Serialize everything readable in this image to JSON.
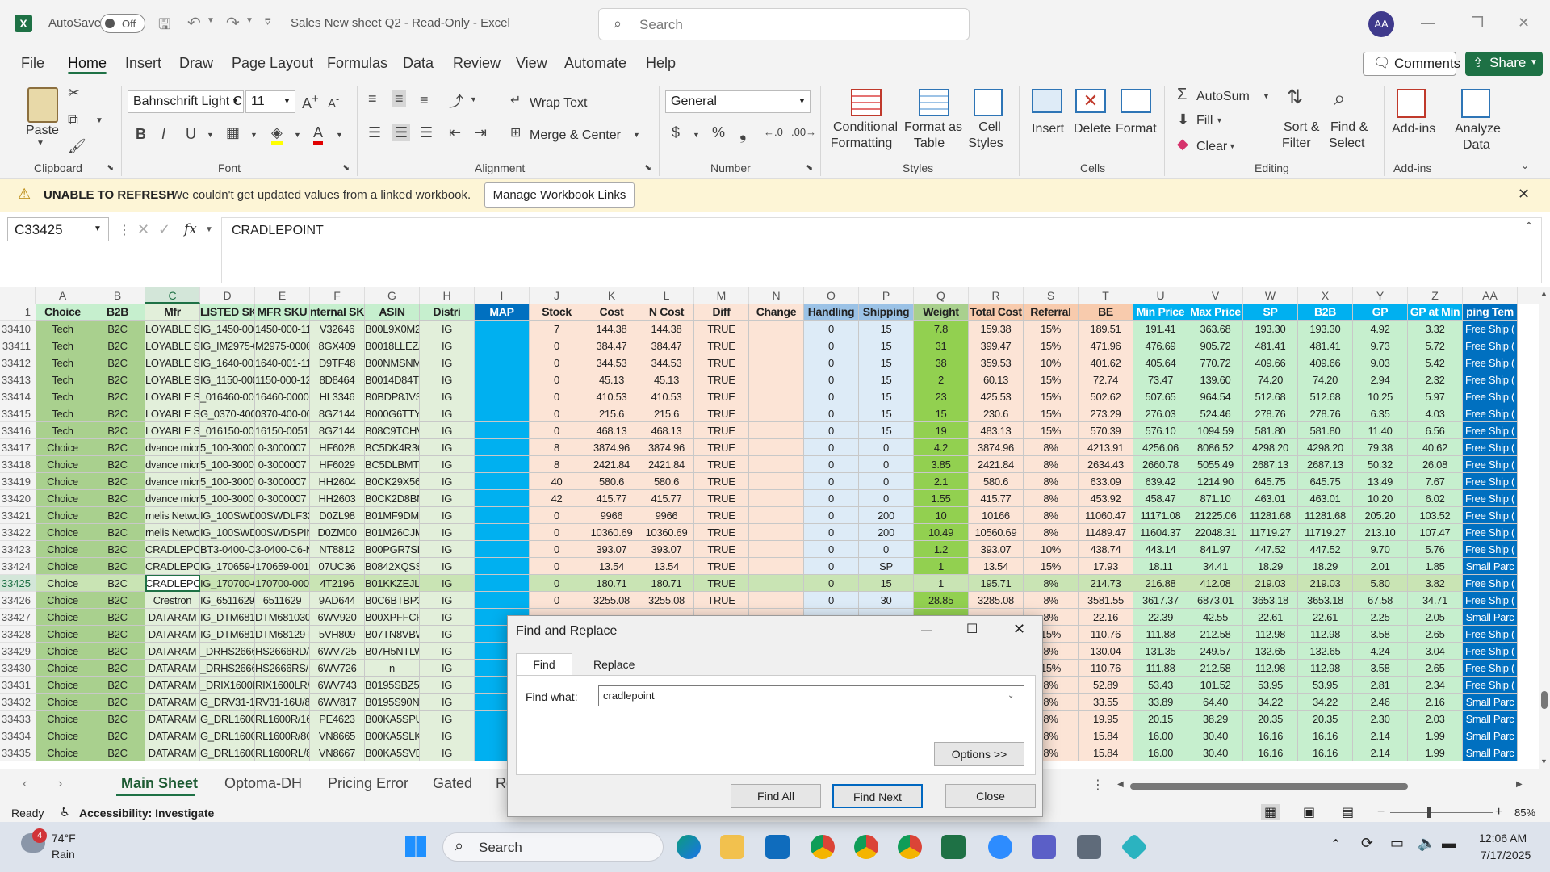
{
  "window": {
    "autosave_label": "AutoSave",
    "autosave_state": "Off",
    "title": "Sales New sheet Q2  -  Read-Only  -  Excel",
    "search_placeholder": "Search",
    "user_initials": "AA"
  },
  "menu": {
    "items": [
      "File",
      "Home",
      "Insert",
      "Draw",
      "Page Layout",
      "Formulas",
      "Data",
      "Review",
      "View",
      "Automate",
      "Help"
    ],
    "comments": "Comments",
    "share": "Share"
  },
  "ribbon": {
    "clipboard": {
      "group": "Clipboard",
      "paste": "Paste"
    },
    "font": {
      "group": "Font",
      "name": "Bahnschrift Light C",
      "size": "11"
    },
    "alignment": {
      "group": "Alignment",
      "wrap": "Wrap Text",
      "merge": "Merge & Center"
    },
    "number": {
      "group": "Number",
      "format": "General"
    },
    "styles": {
      "group": "Styles",
      "conditional": "Conditional",
      "conditional2": "Formatting",
      "format_as": "Format as",
      "format_as2": "Table",
      "cell_styles": "Cell",
      "cell_styles2": "Styles"
    },
    "cells": {
      "group": "Cells",
      "insert": "Insert",
      "delete": "Delete",
      "format": "Format"
    },
    "editing": {
      "group": "Editing",
      "autosum": "AutoSum",
      "fill": "Fill",
      "clear": "Clear",
      "sort": "Sort &",
      "sort2": "Filter",
      "find": "Find &",
      "find2": "Select"
    },
    "addins": {
      "group": "Add-ins",
      "addins": "Add-ins",
      "analyze": "Analyze",
      "analyze2": "Data"
    }
  },
  "notice": {
    "title": "UNABLE TO REFRESH",
    "message": "We couldn't get updated values from a linked workbook.",
    "button": "Manage Workbook Links"
  },
  "formula_bar": {
    "name_box": "C33425",
    "fx": "fx",
    "content": "CRADLEPOINT"
  },
  "grid": {
    "columns": [
      "A",
      "B",
      "C",
      "D",
      "E",
      "F",
      "G",
      "H",
      "I",
      "J",
      "K",
      "L",
      "M",
      "N",
      "O",
      "P",
      "Q",
      "R",
      "S",
      "T",
      "U",
      "V",
      "W",
      "X",
      "Y",
      "Z",
      "AA"
    ],
    "header_row": "1",
    "headers": [
      "Choice",
      "B2B",
      "Mfr",
      "LISTED SKU",
      "MFR SKU",
      "nternal SK",
      "ASIN",
      "Distri",
      "MAP",
      "Stock",
      "Cost",
      "N Cost",
      "Diff",
      "Change",
      "Handling",
      "Shipping",
      "Weight",
      "Total Cost",
      "Referral",
      "BE",
      "Min Price",
      "Max Price",
      "SP",
      "B2B",
      "GP",
      "GP at Min",
      "ping Tem"
    ],
    "rows": [
      {
        "n": "33410",
        "c": [
          "Tech",
          "B2C",
          "LOYABLE SYS",
          "IG_1450-000-110",
          "1450-000-110",
          "V32646",
          "B00L9X0M2",
          "IG",
          "",
          "7",
          "144.38",
          "144.38",
          "TRUE",
          "",
          "0",
          "15",
          "7.8",
          "159.38",
          "15%",
          "189.51",
          "191.41",
          "363.68",
          "193.30",
          "193.30",
          "4.92",
          "3.32",
          "Free Ship ("
        ]
      },
      {
        "n": "33411",
        "c": [
          "Tech",
          "B2C",
          "LOYABLE SYS",
          "IG_IM2975-0000",
          "M2975-0000",
          "8GX409",
          "B0018LLEZA",
          "IG",
          "",
          "0",
          "384.47",
          "384.47",
          "TRUE",
          "",
          "0",
          "15",
          "31",
          "399.47",
          "15%",
          "471.96",
          "476.69",
          "905.72",
          "481.41",
          "481.41",
          "9.73",
          "5.72",
          "Free Ship ("
        ]
      },
      {
        "n": "33412",
        "c": [
          "Tech",
          "B2C",
          "LOYABLE SYS",
          "IG_1640-001-110",
          "1640-001-110",
          "D9TF48",
          "B00NMSNMP2",
          "IG",
          "",
          "0",
          "344.53",
          "344.53",
          "TRUE",
          "",
          "0",
          "15",
          "38",
          "359.53",
          "10%",
          "401.62",
          "405.64",
          "770.72",
          "409.66",
          "409.66",
          "9.03",
          "5.42",
          "Free Ship ("
        ]
      },
      {
        "n": "33413",
        "c": [
          "Tech",
          "B2C",
          "LOYABLE SYS",
          "IG_1150-000-120",
          "1150-000-120",
          "8D8464",
          "B0014D84TQ",
          "IG",
          "",
          "0",
          "45.13",
          "45.13",
          "TRUE",
          "",
          "0",
          "15",
          "2",
          "60.13",
          "15%",
          "72.74",
          "73.47",
          "139.60",
          "74.20",
          "74.20",
          "2.94",
          "2.32",
          "Free Ship ("
        ]
      },
      {
        "n": "33414",
        "c": [
          "Tech",
          "B2C",
          "LOYABLE SYS",
          "_016460-0000-1",
          "16460-0000-1",
          "HL3346",
          "B0BDP8JVS1",
          "IG",
          "",
          "0",
          "410.53",
          "410.53",
          "TRUE",
          "",
          "0",
          "15",
          "23",
          "425.53",
          "15%",
          "502.62",
          "507.65",
          "964.54",
          "512.68",
          "512.68",
          "10.25",
          "5.97",
          "Free Ship ("
        ]
      },
      {
        "n": "33415",
        "c": [
          "Tech",
          "B2C",
          "LOYABLE SYS",
          "G_0370-400-00",
          "0370-400-00",
          "8GZ144",
          "B000G6TTY6",
          "IG",
          "",
          "0",
          "215.6",
          "215.6",
          "TRUE",
          "",
          "0",
          "15",
          "15",
          "230.6",
          "15%",
          "273.29",
          "276.03",
          "524.46",
          "278.76",
          "278.76",
          "6.35",
          "4.03",
          "Free Ship ("
        ]
      },
      {
        "n": "33416",
        "c": [
          "Tech",
          "B2C",
          "LOYABLE SYS",
          "_016150-0051-1",
          "16150-0051-1",
          "8GZ144",
          "B08C9TCHV2",
          "IG",
          "",
          "0",
          "468.13",
          "468.13",
          "TRUE",
          "",
          "0",
          "15",
          "19",
          "483.13",
          "15%",
          "570.39",
          "576.10",
          "1094.59",
          "581.80",
          "581.80",
          "11.40",
          "6.56",
          "Free Ship ("
        ]
      },
      {
        "n": "33417",
        "c": [
          "Choice",
          "B2C",
          "dvance micr",
          "5_100-3000007",
          "0-3000007",
          "HF6028",
          "BC5DK4R3G",
          "IG",
          "",
          "8",
          "3874.96",
          "3874.96",
          "TRUE",
          "",
          "0",
          "0",
          "4.2",
          "3874.96",
          "8%",
          "4213.91",
          "4256.06",
          "8086.52",
          "4298.20",
          "4298.20",
          "79.38",
          "40.62",
          "Free Ship ("
        ]
      },
      {
        "n": "33418",
        "c": [
          "Choice",
          "B2C",
          "dvance micr",
          "5_100-3000007",
          "0-3000007",
          "HF6029",
          "BC5DLBMTF",
          "IG",
          "",
          "8",
          "2421.84",
          "2421.84",
          "TRUE",
          "",
          "0",
          "0",
          "3.85",
          "2421.84",
          "8%",
          "2634.43",
          "2660.78",
          "5055.49",
          "2687.13",
          "2687.13",
          "50.32",
          "26.08",
          "Free Ship ("
        ]
      },
      {
        "n": "33419",
        "c": [
          "Choice",
          "B2C",
          "dvance micr",
          "5_100-3000007",
          "0-3000007",
          "HH2604",
          "B0CK29X56V",
          "IG",
          "",
          "40",
          "580.6",
          "580.6",
          "TRUE",
          "",
          "0",
          "0",
          "2.1",
          "580.6",
          "8%",
          "633.09",
          "639.42",
          "1214.90",
          "645.75",
          "645.75",
          "13.49",
          "7.67",
          "Free Ship ("
        ]
      },
      {
        "n": "33420",
        "c": [
          "Choice",
          "B2C",
          "dvance micr",
          "5_100-3000007",
          "0-3000007",
          "HH2603",
          "B0CK2D8BNY",
          "IG",
          "",
          "42",
          "415.77",
          "415.77",
          "TRUE",
          "",
          "0",
          "0",
          "1.55",
          "415.77",
          "8%",
          "453.92",
          "458.47",
          "871.10",
          "463.01",
          "463.01",
          "10.20",
          "6.02",
          "Free Ship ("
        ]
      },
      {
        "n": "33421",
        "c": [
          "Choice",
          "B2C",
          "rnelis Netwo",
          "IG_100SWDLF32",
          "00SWDLF32",
          "D0ZL98",
          "B01MF9DMC0",
          "IG",
          "",
          "0",
          "9966",
          "9966",
          "TRUE",
          "",
          "0",
          "200",
          "10",
          "10166",
          "8%",
          "11060.47",
          "11171.08",
          "21225.06",
          "11281.68",
          "11281.68",
          "205.20",
          "103.52",
          "Free Ship ("
        ]
      },
      {
        "n": "33422",
        "c": [
          "Choice",
          "B2C",
          "rnelis Netwo",
          "IG_100SWDSPINE",
          "00SWDSPINE",
          "D0ZM00",
          "B01M26CJM4",
          "IG",
          "",
          "0",
          "10360.69",
          "10360.69",
          "TRUE",
          "",
          "0",
          "200",
          "10.49",
          "10560.69",
          "8%",
          "11489.47",
          "11604.37",
          "22048.31",
          "11719.27",
          "11719.27",
          "213.10",
          "107.47",
          "Free Ship ("
        ]
      },
      {
        "n": "33423",
        "c": [
          "Choice",
          "B2C",
          "CRADLEPOINT",
          "BT3-0400-C6-N",
          "3-0400-C6-N",
          "NT8812",
          "B00PGR7SPX",
          "IG",
          "",
          "0",
          "393.07",
          "393.07",
          "TRUE",
          "",
          "0",
          "0",
          "1.2",
          "393.07",
          "10%",
          "438.74",
          "443.14",
          "841.97",
          "447.52",
          "447.52",
          "9.70",
          "5.76",
          "Free Ship ("
        ]
      },
      {
        "n": "33424",
        "c": [
          "Choice",
          "B2C",
          "CRADLEPOINT",
          "IG_170659-001",
          "170659-001",
          "07UC36",
          "B0842XQSSY",
          "IG",
          "",
          "0",
          "13.54",
          "13.54",
          "TRUE",
          "",
          "0",
          "SP",
          "1",
          "13.54",
          "15%",
          "17.93",
          "18.11",
          "34.41",
          "18.29",
          "18.29",
          "2.01",
          "1.85",
          "Small Parc"
        ]
      },
      {
        "n": "33425",
        "c": [
          "Choice",
          "B2C",
          "CRADLEPOINT",
          "IG_170700-000",
          "170700-000",
          "4T2196",
          "B01KKZEJLK",
          "IG",
          "",
          "0",
          "180.71",
          "180.71",
          "TRUE",
          "",
          "0",
          "15",
          "1",
          "195.71",
          "8%",
          "214.73",
          "216.88",
          "412.08",
          "219.03",
          "219.03",
          "5.80",
          "3.82",
          "Free Ship ("
        ]
      },
      {
        "n": "33426",
        "c": [
          "Choice",
          "B2C",
          "Crestron",
          "IG_6511629",
          "6511629",
          "9AD644",
          "B0C6BTBP3B",
          "IG",
          "",
          "0",
          "3255.08",
          "3255.08",
          "TRUE",
          "",
          "0",
          "30",
          "28.85",
          "3285.08",
          "8%",
          "3581.55",
          "3617.37",
          "6873.01",
          "3653.18",
          "3653.18",
          "67.58",
          "34.71",
          "Free Ship ("
        ]
      },
      {
        "n": "33427",
        "c": [
          "Choice",
          "B2C",
          "DATARAM",
          "IG_DTM681030",
          "DTM681030",
          "6WV920",
          "B00XPFFCP4",
          "IG",
          "",
          "",
          "",
          "",
          "",
          "",
          "",
          "",
          "",
          "",
          "8%",
          "22.16",
          "22.39",
          "42.55",
          "22.61",
          "22.61",
          "2.25",
          "2.05",
          "Small Parc"
        ]
      },
      {
        "n": "33428",
        "c": [
          "Choice",
          "B2C",
          "DATARAM",
          "IG_DTM68129-H",
          "DTM68129-H",
          "5VH809",
          "B07TN8VBWS",
          "IG",
          "",
          "",
          "",
          "",
          "",
          "",
          "",
          "",
          "",
          "",
          "15%",
          "110.76",
          "111.88",
          "212.58",
          "112.98",
          "112.98",
          "3.58",
          "2.65",
          "Free Ship ("
        ]
      },
      {
        "n": "33429",
        "c": [
          "Choice",
          "B2C",
          "DATARAM",
          "_DRHS2666RD/32",
          "HS2666RD/32",
          "6WV725",
          "B07H5NTLWR",
          "IG",
          "",
          "",
          "",
          "",
          "",
          "",
          "",
          "",
          "",
          "",
          "8%",
          "130.04",
          "131.35",
          "249.57",
          "132.65",
          "132.65",
          "4.24",
          "3.04",
          "Free Ship ("
        ]
      },
      {
        "n": "33430",
        "c": [
          "Choice",
          "B2C",
          "DATARAM",
          "_DRHS2666RS/16",
          "HS2666RS/16",
          "6WV726",
          "n",
          "IG",
          "",
          "",
          "",
          "",
          "",
          "",
          "",
          "",
          "",
          "",
          "15%",
          "110.76",
          "111.88",
          "212.58",
          "112.98",
          "112.98",
          "3.58",
          "2.65",
          "Free Ship ("
        ]
      },
      {
        "n": "33431",
        "c": [
          "Choice",
          "B2C",
          "DATARAM",
          "_DRIX1600LR/32",
          "RIX1600LR/32",
          "6WV743",
          "B0195SBZ54",
          "IG",
          "",
          "",
          "",
          "",
          "",
          "",
          "",
          "",
          "",
          "",
          "8%",
          "52.89",
          "53.43",
          "101.52",
          "53.95",
          "53.95",
          "2.81",
          "2.34",
          "Free Ship ("
        ]
      },
      {
        "n": "33432",
        "c": [
          "Choice",
          "B2C",
          "DATARAM",
          "G_DRV31-16U/8G",
          "RV31-16U/8G",
          "6WV817",
          "B0195S90NU",
          "IG",
          "",
          "",
          "",
          "",
          "",
          "",
          "",
          "",
          "",
          "",
          "8%",
          "33.55",
          "33.89",
          "64.40",
          "34.22",
          "34.22",
          "2.46",
          "2.16",
          "Small Parc"
        ]
      },
      {
        "n": "33433",
        "c": [
          "Choice",
          "B2C",
          "DATARAM",
          "G_DRL1600R/16G",
          "RL1600R/16G",
          "PE4623",
          "B00KA5SPUC",
          "IG",
          "",
          "",
          "",
          "",
          "",
          "",
          "",
          "",
          "",
          "",
          "8%",
          "19.95",
          "20.15",
          "38.29",
          "20.35",
          "20.35",
          "2.30",
          "2.03",
          "Small Parc"
        ]
      },
      {
        "n": "33434",
        "c": [
          "Choice",
          "B2C",
          "DATARAM",
          "G_DRL1600R/8G",
          "RL1600R/8G",
          "VN8665",
          "B00KA5SLKQ",
          "IG",
          "",
          "",
          "",
          "",
          "",
          "",
          "",
          "",
          "",
          "",
          "8%",
          "15.84",
          "16.00",
          "30.40",
          "16.16",
          "16.16",
          "2.14",
          "1.99",
          "Small Parc"
        ]
      },
      {
        "n": "33435",
        "c": [
          "Choice",
          "B2C",
          "DATARAM",
          "G_DRL1600RL/8G",
          "RL1600RL/8G",
          "VN8667",
          "B00KA5SVBK",
          "IG",
          "",
          "",
          "",
          "",
          "",
          "",
          "",
          "",
          "",
          "",
          "8%",
          "15.84",
          "16.00",
          "30.40",
          "16.16",
          "16.16",
          "2.14",
          "1.99",
          "Small Parc"
        ]
      }
    ]
  },
  "dialog": {
    "title": "Find and Replace",
    "tab_find": "Find",
    "tab_replace": "Replace",
    "find_label": "Find what:",
    "find_value": "cradlepoint",
    "options": "Options >>",
    "find_all": "Find All",
    "find_next": "Find Next",
    "close": "Close"
  },
  "sheets": {
    "tabs": [
      "Main Sheet",
      "Optoma-DH",
      "Pricing Error",
      "Gated",
      "Re"
    ]
  },
  "statusbar": {
    "ready": "Ready",
    "accessibility": "Accessibility: Investigate",
    "zoom": "85%"
  },
  "taskbar": {
    "weather_temp": "74°F",
    "weather_desc": "Rain",
    "badge": "4",
    "search": "Search",
    "time": "12:06 AM",
    "date": "7/17/2025"
  },
  "colors": {
    "excel_green": "#1e7145",
    "header_fill": "#c6efce",
    "blue_header": "#0070c0",
    "cyan_col": "#00b0f0",
    "notice_bg": "#fdf5d6"
  }
}
